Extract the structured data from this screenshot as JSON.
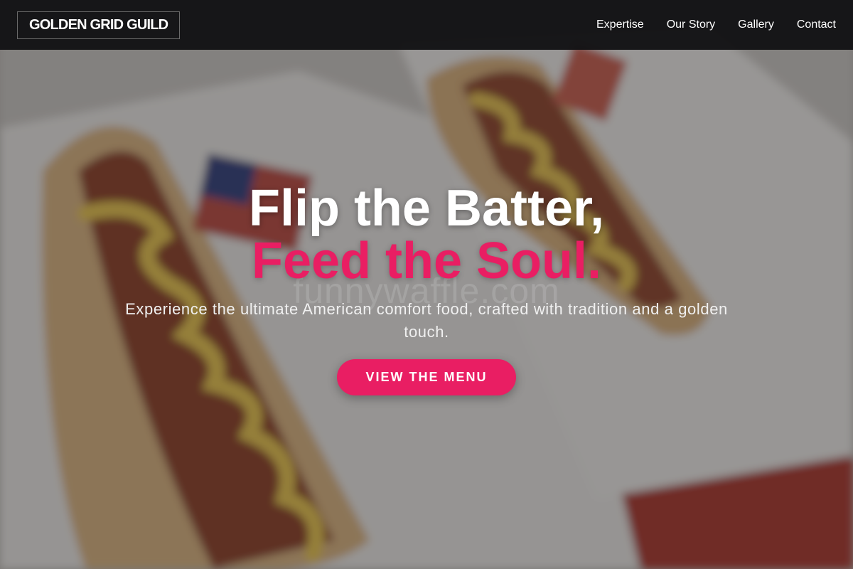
{
  "nav": {
    "logo": "GOLDEN GRID GUILD",
    "links": [
      "Expertise",
      "Our Story",
      "Gallery",
      "Contact"
    ]
  },
  "hero": {
    "headline_line1": "Flip the Batter,",
    "headline_line2": "Feed the Soul.",
    "watermark": "funnywaffle.com",
    "subtitle": "Experience the ultimate American comfort food, crafted with tradition and a golden touch.",
    "cta_label": "VIEW THE MENU",
    "background_image": "hot-dogs-with-mustard-ketchup-and-american-flags"
  },
  "colors": {
    "accent": "#e91e63",
    "navbar": "#121214",
    "text": "#ffffff"
  }
}
